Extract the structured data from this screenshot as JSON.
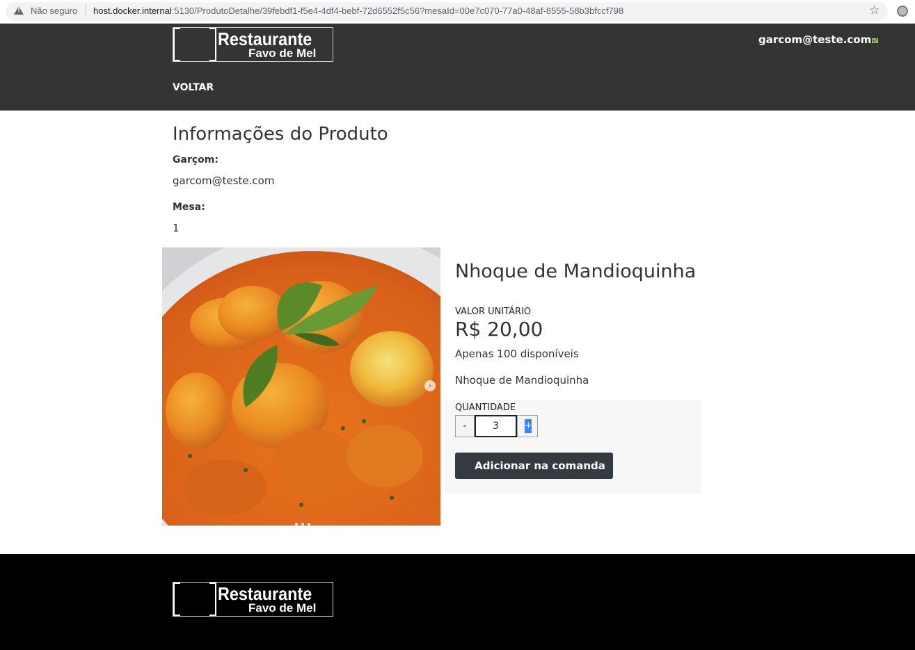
{
  "browser": {
    "not_secure": "Não seguro",
    "url_host": "host.docker.internal",
    "url_rest": ":5130/ProdutoDetalhe/39febdf1-f5e4-4df4-bebf-72d6552f5c56?mesaId=00e7c070-77a0-48af-8555-58b3bfccf798"
  },
  "header": {
    "logo_name": "Restaurante",
    "logo_sub": "Favo de Mel",
    "user_email": "garcom@teste.com",
    "back_label": "VOLTAR"
  },
  "main": {
    "title": "Informações do Produto",
    "waiter_label": "Garçom:",
    "waiter_value": "garcom@teste.com",
    "table_label": "Mesa:",
    "table_value": "1"
  },
  "product": {
    "name": "Nhoque de Mandioquinha",
    "unit_label": "VALOR UNITÁRIO",
    "price": "R$ 20,00",
    "stock": "Apenas 100 disponíveis",
    "description": "Nhoque de Mandioquinha",
    "qty_label": "QUANTIDADE",
    "qty_minus": "-",
    "qty_value": "3",
    "qty_plus": "+",
    "add_button": "Adicionar na comanda"
  },
  "footer": {
    "logo_name": "Restaurante",
    "logo_sub": "Favo de Mel"
  },
  "icons": {
    "warning": "warning-icon",
    "star": "star-icon",
    "mail": "mail-check-icon",
    "next": "chevron-right-icon"
  },
  "colors": {
    "header_bg": "#343434",
    "footer_bg": "#000000",
    "button_bg": "#343a40",
    "accent": "#3b82f6"
  }
}
